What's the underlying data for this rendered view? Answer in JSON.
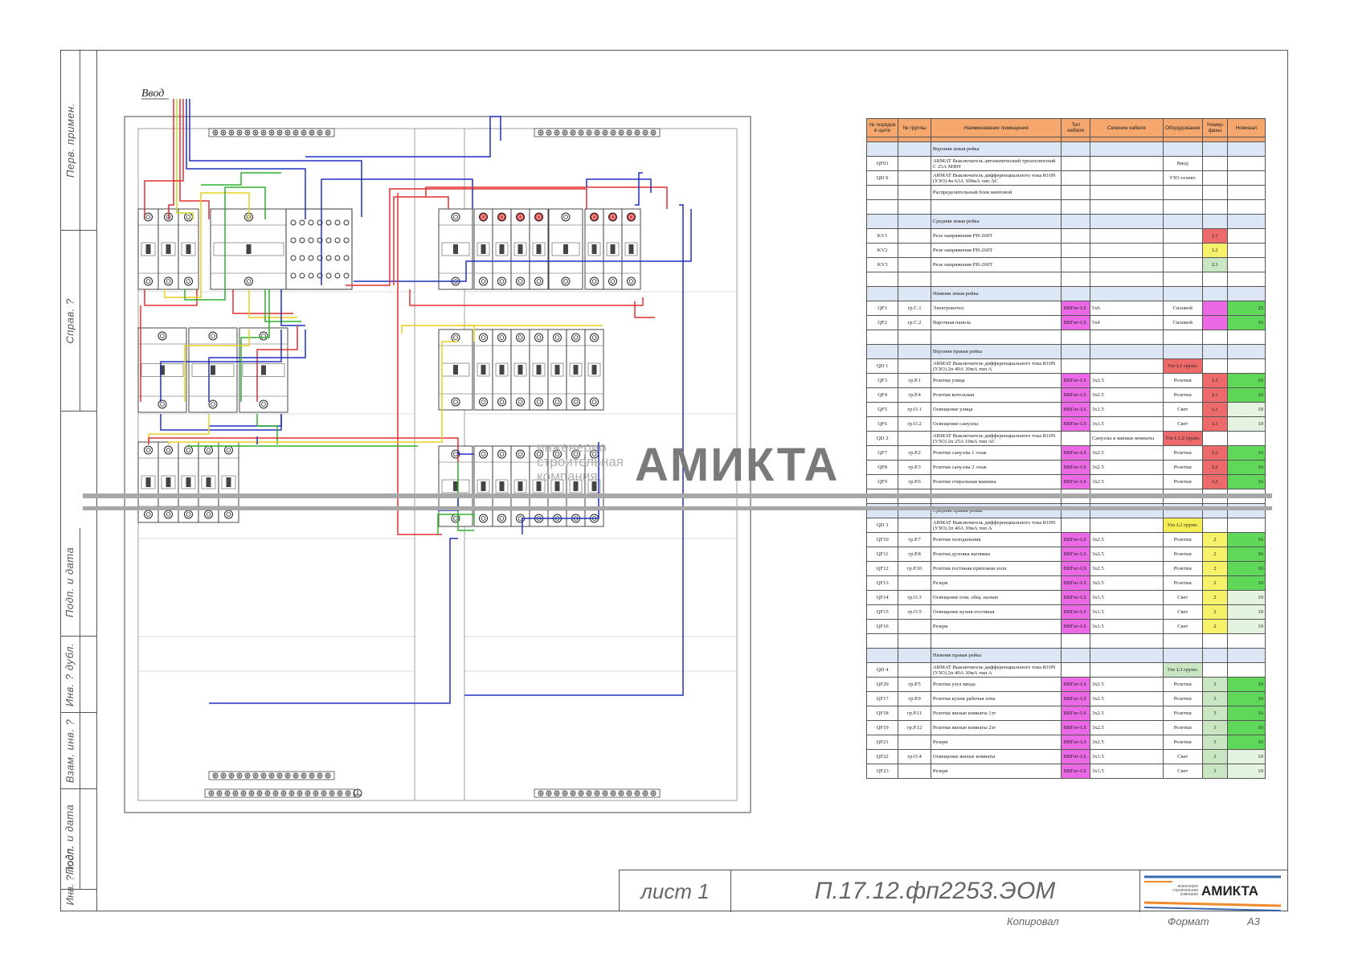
{
  "schematic": {
    "input_label": "Ввод"
  },
  "side_labels": [
    "Перв. примен.",
    "Справ. ?",
    "Подп. и дата",
    "Инв. ? дубл.",
    "Взам. инв. ?",
    "Подп. и дата",
    "Инв. ? подл."
  ],
  "table": {
    "headers": [
      "№ порядок в щите",
      "№ группы",
      "Наименование помещения",
      "Тип кабеля",
      "Сечение кабеля",
      "Оборудование",
      "Номер фазы",
      "Номинал"
    ],
    "rows": [
      {
        "type": "section",
        "name": "Верхняя левая рейка"
      },
      {
        "id": "QF01",
        "grp": "",
        "name": "ARMAT Выключатель автоматический трехполюсный С 25А МФН",
        "cab": "",
        "sec": "",
        "eq": "Ввод",
        "ph": "",
        "nom": "",
        "c_cab": "",
        "c_eq": "",
        "c_ph": "",
        "c_nom": ""
      },
      {
        "id": "QD S",
        "grp": "",
        "name": "ARMAT Выключатель дифференциального тока R10N (УЗО) 4п 63А 300мА тип АС",
        "cab": "",
        "sec": "",
        "eq": "УЗО селект.",
        "ph": "",
        "nom": "",
        "c_cab": "",
        "c_eq": "",
        "c_ph": "",
        "c_nom": ""
      },
      {
        "id": "",
        "grp": "",
        "name": "Распределительный блок винтовой",
        "cab": "",
        "sec": "",
        "eq": "",
        "ph": "",
        "nom": "",
        "c_cab": "",
        "c_eq": "",
        "c_ph": "",
        "c_nom": ""
      },
      {
        "type": "empty"
      },
      {
        "type": "section",
        "name": "Средняя левая рейка"
      },
      {
        "id": "KV1",
        "grp": "",
        "name": "Реле напряжения РН-260Т",
        "cab": "",
        "sec": "",
        "eq": "",
        "ph": "L1",
        "nom": "",
        "c_cab": "",
        "c_eq": "",
        "c_ph": "bg-red",
        "c_nom": ""
      },
      {
        "id": "KV2",
        "grp": "",
        "name": "Реле напряжения РН-260Т",
        "cab": "",
        "sec": "",
        "eq": "",
        "ph": "L2",
        "nom": "",
        "c_cab": "",
        "c_eq": "",
        "c_ph": "bg-yel",
        "c_nom": ""
      },
      {
        "id": "KV3",
        "grp": "",
        "name": "Реле напряжения РН-260Т",
        "cab": "",
        "sec": "",
        "eq": "",
        "ph": "L3",
        "nom": "",
        "c_cab": "",
        "c_eq": "",
        "c_ph": "bg-lgr",
        "c_nom": ""
      },
      {
        "type": "empty"
      },
      {
        "type": "section",
        "name": "Нижняя левая рейка"
      },
      {
        "id": "QF1",
        "grp": "гр.С.1",
        "name": "Электрокотел",
        "cab": "ВВГнг-LS",
        "sec": "5х6",
        "eq": "Силовой",
        "ph": "",
        "nom": "25",
        "c_cab": "bg-mag",
        "c_eq": "",
        "c_ph": "bg-mag",
        "c_nom": "bg-grn"
      },
      {
        "id": "QF2",
        "grp": "гр.С.2",
        "name": "Варочная панель",
        "cab": "ВВГнг-LS",
        "sec": "5х4",
        "eq": "Силовой",
        "ph": "",
        "nom": "16",
        "c_cab": "bg-mag",
        "c_eq": "",
        "c_ph": "bg-mag",
        "c_nom": "bg-grn"
      },
      {
        "type": "empty"
      },
      {
        "type": "section",
        "name": "Верхняя правая рейка"
      },
      {
        "id": "QD 1",
        "grp": "",
        "name": "ARMAT Выключатель дифференциального тока R10N (УЗО) 2п 40А 30мА тип А",
        "cab": "",
        "sec": "",
        "eq": "Узо L1 групп.",
        "ph": "",
        "nom": "",
        "c_cab": "",
        "c_eq": "bg-red",
        "c_ph": "",
        "c_nom": ""
      },
      {
        "id": "QF3",
        "grp": "гр.Р.1",
        "name": "Розетки улица",
        "cab": "ВВГнг-LS",
        "sec": "3х2.5",
        "eq": "Розетки",
        "ph": "L1",
        "nom": "16",
        "c_cab": "bg-mag",
        "c_eq": "",
        "c_ph": "bg-red",
        "c_nom": "bg-grn"
      },
      {
        "id": "QF4",
        "grp": "гр.Р.4",
        "name": "Розетки котельная",
        "cab": "ВВГнг-LS",
        "sec": "3х2.5",
        "eq": "Розетки",
        "ph": "L1",
        "nom": "16",
        "c_cab": "bg-mag",
        "c_eq": "",
        "c_ph": "bg-red",
        "c_nom": "bg-grn"
      },
      {
        "id": "QF5",
        "grp": "гр.О.1",
        "name": "Освещение улица",
        "cab": "ВВГнг-LS",
        "sec": "3х1.5",
        "eq": "Свет",
        "ph": "L1",
        "nom": "10",
        "c_cab": "bg-mag",
        "c_eq": "",
        "c_ph": "bg-red",
        "c_nom": "bg-pale"
      },
      {
        "id": "QF6",
        "grp": "гр.О.2",
        "name": "Освещение санузлы",
        "cab": "ВВГнг-LS",
        "sec": "3х1.5",
        "eq": "Свет",
        "ph": "L1",
        "nom": "10",
        "c_cab": "bg-mag",
        "c_eq": "",
        "c_ph": "bg-red",
        "c_nom": "bg-pale"
      },
      {
        "id": "QD 2",
        "grp": "",
        "name": "ARMAT Выключатель дифференциального тока R10N (УЗО) 2п 25А 10мА тип АС",
        "cab": "",
        "sec": "Санузлы и ванные комнаты",
        "eq": "Узо L1.2 групп.",
        "ph": "",
        "nom": "",
        "c_cab": "",
        "c_eq": "bg-red",
        "c_ph": "",
        "c_nom": ""
      },
      {
        "id": "QF7",
        "grp": "гр.Р.2",
        "name": "Розетки санузлы 1 этаж",
        "cab": "ВВГнг-LS",
        "sec": "3х2.5",
        "eq": "Розетки",
        "ph": "L2",
        "nom": "16",
        "c_cab": "bg-mag",
        "c_eq": "",
        "c_ph": "bg-red",
        "c_nom": "bg-grn"
      },
      {
        "id": "QF8",
        "grp": "гр.Р.3",
        "name": "Розетки санузлы 2 этаж",
        "cab": "ВВГнг-LS",
        "sec": "3х2.5",
        "eq": "Розетки",
        "ph": "L2",
        "nom": "16",
        "c_cab": "bg-mag",
        "c_eq": "",
        "c_ph": "bg-red",
        "c_nom": "bg-grn"
      },
      {
        "id": "QF9",
        "grp": "гр.Р.6",
        "name": "Розетки стиральная машина",
        "cab": "ВВГнг-LS",
        "sec": "3х2.5",
        "eq": "Розетки",
        "ph": "L2",
        "nom": "16",
        "c_cab": "bg-mag",
        "c_eq": "",
        "c_ph": "bg-red",
        "c_nom": "bg-grn"
      },
      {
        "type": "empty"
      },
      {
        "type": "section",
        "name": "Средняя правая рейка"
      },
      {
        "id": "QD 3",
        "grp": "",
        "name": "ARMAT Выключатель дифференциального тока R10N (УЗО) 2п 40А 30мА тип А",
        "cab": "",
        "sec": "",
        "eq": "Узо L2 групп.",
        "ph": "",
        "nom": "",
        "c_cab": "",
        "c_eq": "bg-yel2",
        "c_ph": "",
        "c_nom": ""
      },
      {
        "id": "QF10",
        "grp": "гр.Р.7",
        "name": "Розетки холодильник",
        "cab": "ВВГнг-LS",
        "sec": "3х2.5",
        "eq": "Розетки",
        "ph": "2",
        "nom": "16",
        "c_cab": "bg-mag",
        "c_eq": "",
        "c_ph": "bg-yel",
        "c_nom": "bg-grn"
      },
      {
        "id": "QF11",
        "grp": "гр.Р.8",
        "name": "Розетки духовка вытяжка",
        "cab": "ВВГнг-LS",
        "sec": "3х2.5",
        "eq": "Розетки",
        "ph": "2",
        "nom": "16",
        "c_cab": "bg-mag",
        "c_eq": "",
        "c_ph": "bg-yel",
        "c_nom": "bg-grn"
      },
      {
        "id": "QF12",
        "grp": "гр.Р.10",
        "name": "Розетки гостиная прихожая холл",
        "cab": "ВВГнг-LS",
        "sec": "3х2.5",
        "eq": "Розетки",
        "ph": "2",
        "nom": "16",
        "c_cab": "bg-mag",
        "c_eq": "",
        "c_ph": "bg-yel",
        "c_nom": "bg-grn"
      },
      {
        "id": "QF13",
        "grp": "",
        "name": "Резерв",
        "cab": "ВВГнг-LS",
        "sec": "3х2.5",
        "eq": "Розетки",
        "ph": "2",
        "nom": "16",
        "c_cab": "bg-mag",
        "c_eq": "",
        "c_ph": "bg-yel",
        "c_nom": "bg-grn"
      },
      {
        "id": "QF14",
        "grp": "гр.О.3",
        "name": "Освещение пом. общ. назнач",
        "cab": "ВВГнг-LS",
        "sec": "3х1.5",
        "eq": "Свет",
        "ph": "2",
        "nom": "10",
        "c_cab": "bg-mag",
        "c_eq": "",
        "c_ph": "bg-yel",
        "c_nom": "bg-pale"
      },
      {
        "id": "QF15",
        "grp": "гр.О.5",
        "name": "Освещение кухня-гостиная",
        "cab": "ВВГнг-LS",
        "sec": "3х1.5",
        "eq": "Свет",
        "ph": "2",
        "nom": "10",
        "c_cab": "bg-mag",
        "c_eq": "",
        "c_ph": "bg-yel",
        "c_nom": "bg-pale"
      },
      {
        "id": "QF16",
        "grp": "",
        "name": "Резерв",
        "cab": "ВВГнг-LS",
        "sec": "3х1.5",
        "eq": "Свет",
        "ph": "2",
        "nom": "10",
        "c_cab": "bg-mag",
        "c_eq": "",
        "c_ph": "bg-yel",
        "c_nom": "bg-pale"
      },
      {
        "type": "empty"
      },
      {
        "type": "section",
        "name": "Нижняя правая рейка"
      },
      {
        "id": "QD 4",
        "grp": "",
        "name": "ARMAT Выключатель дифференциального тока R10N (УЗО) 2п 40А 30мА тип А",
        "cab": "",
        "sec": "",
        "eq": "Узо L3 групп.",
        "ph": "",
        "nom": "",
        "c_cab": "",
        "c_eq": "bg-lgr",
        "c_ph": "",
        "c_nom": ""
      },
      {
        "id": "QF20",
        "grp": "гр.Р.5",
        "name": "Розетки узел ввода",
        "cab": "ВВГнг-LS",
        "sec": "3х2.5",
        "eq": "Розетки",
        "ph": "3",
        "nom": "16",
        "c_cab": "bg-mag",
        "c_eq": "",
        "c_ph": "bg-lgr",
        "c_nom": "bg-grn"
      },
      {
        "id": "QF17",
        "grp": "гр.Р.9",
        "name": "Розетки кухня рабочая зона",
        "cab": "ВВГнг-LS",
        "sec": "3х2.5",
        "eq": "Розетки",
        "ph": "3",
        "nom": "16",
        "c_cab": "bg-mag",
        "c_eq": "",
        "c_ph": "bg-lgr",
        "c_nom": "bg-grn"
      },
      {
        "id": "QF18",
        "grp": "гр.Р.11",
        "name": "Розетки жилые комнаты 1эт",
        "cab": "ВВГнг-LS",
        "sec": "3х2.5",
        "eq": "Розетки",
        "ph": "3",
        "nom": "16",
        "c_cab": "bg-mag",
        "c_eq": "",
        "c_ph": "bg-lgr",
        "c_nom": "bg-grn"
      },
      {
        "id": "QF19",
        "grp": "гр.Р.12",
        "name": "Розетки жилые комнаты 2эт",
        "cab": "ВВГнг-LS",
        "sec": "3х2.5",
        "eq": "Розетки",
        "ph": "3",
        "nom": "16",
        "c_cab": "bg-mag",
        "c_eq": "",
        "c_ph": "bg-lgr",
        "c_nom": "bg-grn"
      },
      {
        "id": "QF21",
        "grp": "",
        "name": "Резерв",
        "cab": "ВВГнг-LS",
        "sec": "3х2.5",
        "eq": "Розетки",
        "ph": "3",
        "nom": "16",
        "c_cab": "bg-mag",
        "c_eq": "",
        "c_ph": "bg-lgr",
        "c_nom": "bg-grn"
      },
      {
        "id": "QF22",
        "grp": "гр.О.4",
        "name": "Освещение жилые комнаты",
        "cab": "ВВГнг-LS",
        "sec": "3х1.5",
        "eq": "Свет",
        "ph": "3",
        "nom": "10",
        "c_cab": "bg-mag",
        "c_eq": "",
        "c_ph": "bg-lgr",
        "c_nom": "bg-pale"
      },
      {
        "id": "QF23",
        "grp": "",
        "name": "Резерв",
        "cab": "ВВГнг-LS",
        "sec": "3х1.5",
        "eq": "Свет",
        "ph": "3",
        "nom": "10",
        "c_cab": "bg-mag",
        "c_eq": "",
        "c_ph": "bg-lgr",
        "c_nom": "bg-pale"
      }
    ]
  },
  "watermark": {
    "text": "АМИКТА",
    "sub": "инженерно строительная компания"
  },
  "title_block": {
    "sheet": "лист 1",
    "code": "П.17.12.фп2253.ЭОМ",
    "logo_text": "АМИКТА",
    "logo_sub": "инженерно строительная компания"
  },
  "footer": {
    "copied": "Копировал",
    "format_label": "Формат",
    "format_value": "А3"
  },
  "colors": {
    "L1": "#e03030",
    "L2": "#e8d020",
    "L3": "#30b030",
    "N": "#2030c0",
    "PE": "#20b020",
    "yellow_green": "#c8d820"
  }
}
